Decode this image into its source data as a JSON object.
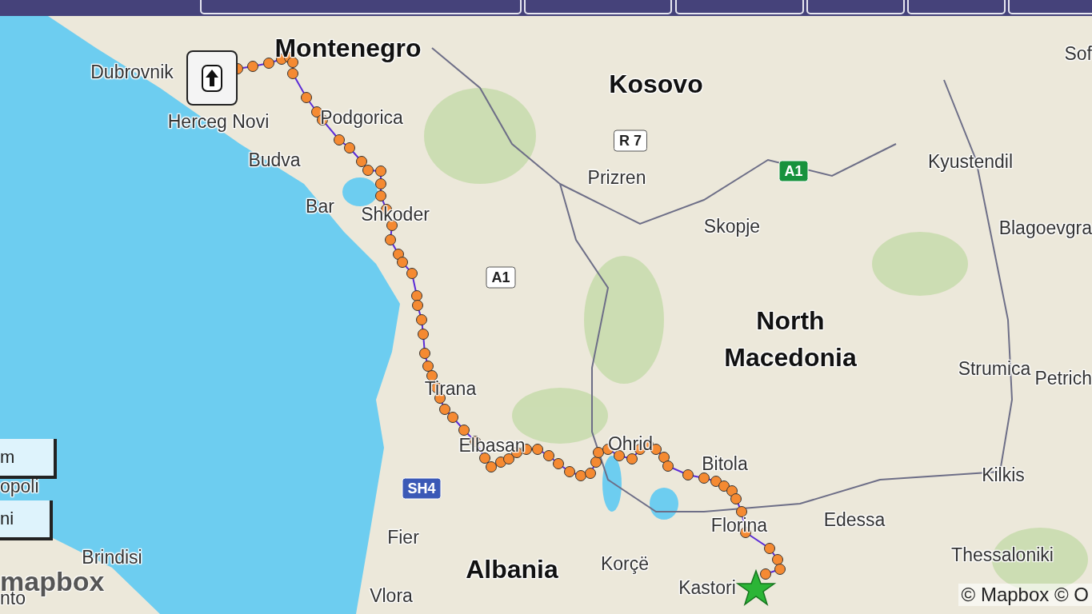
{
  "map": {
    "labels": [
      {
        "text": "Montenegro",
        "kind": "country"
      },
      {
        "text": "Kosovo",
        "kind": "country"
      },
      {
        "text": "North Macedonia",
        "kind": "country"
      },
      {
        "text": "Albania",
        "kind": "country"
      },
      {
        "text": "Dubrovnik",
        "kind": "city"
      },
      {
        "text": "Herceg Novi",
        "kind": "city"
      },
      {
        "text": "Podgorica",
        "kind": "city"
      },
      {
        "text": "Budva",
        "kind": "city"
      },
      {
        "text": "Bar",
        "kind": "city"
      },
      {
        "text": "Shkoder",
        "kind": "city"
      },
      {
        "text": "Prizren",
        "kind": "city"
      },
      {
        "text": "Skopje",
        "kind": "city"
      },
      {
        "text": "Sof",
        "kind": "city"
      },
      {
        "text": "Kyustendil",
        "kind": "city"
      },
      {
        "text": "Blagoevgra",
        "kind": "city"
      },
      {
        "text": "Tirana",
        "kind": "city"
      },
      {
        "text": "Elbasan",
        "kind": "city"
      },
      {
        "text": "Ohrid",
        "kind": "city"
      },
      {
        "text": "Bitola",
        "kind": "city"
      },
      {
        "text": "Florina",
        "kind": "city"
      },
      {
        "text": "Edessa",
        "kind": "city"
      },
      {
        "text": "Strumica",
        "kind": "city"
      },
      {
        "text": "Petrich",
        "kind": "city"
      },
      {
        "text": "Kilkis",
        "kind": "city"
      },
      {
        "text": "Thessaloniki",
        "kind": "city"
      },
      {
        "text": "Kastori",
        "kind": "city"
      },
      {
        "text": "Korçë",
        "kind": "city"
      },
      {
        "text": "Fier",
        "kind": "city"
      },
      {
        "text": "Vlora",
        "kind": "city"
      },
      {
        "text": "Brindisi",
        "kind": "city"
      },
      {
        "text": "opoli",
        "kind": "city"
      },
      {
        "text": "nto",
        "kind": "city"
      }
    ],
    "shields": [
      {
        "text": "R 7",
        "kind": "white"
      },
      {
        "text": "A1",
        "kind": "white"
      },
      {
        "text": "A1",
        "kind": "green"
      },
      {
        "text": "SH4",
        "kind": "blue"
      }
    ]
  },
  "layer_buttons": [
    {
      "label": "m"
    },
    {
      "label": "ni"
    }
  ],
  "attribution": {
    "logo": "mapbox",
    "text": "© Mapbox © O"
  }
}
